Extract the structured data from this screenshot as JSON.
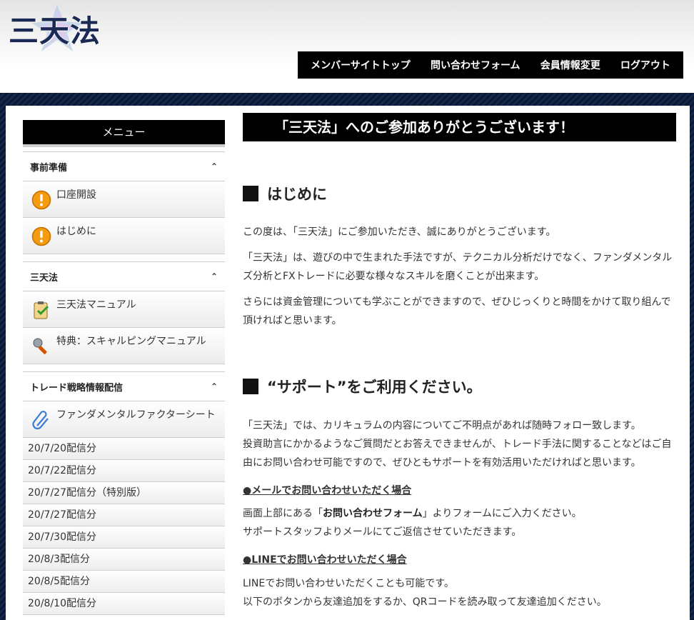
{
  "header": {
    "logo_text": "三天法",
    "nav": [
      {
        "label": "メンバーサイトトップ"
      },
      {
        "label": "問い合わせフォーム"
      },
      {
        "label": "会員情報変更"
      },
      {
        "label": "ログアウト"
      }
    ]
  },
  "sidebar": {
    "title": "メニュー",
    "sections": [
      {
        "title": "事前準備",
        "items": [
          "口座開設",
          "はじめに"
        ]
      },
      {
        "title": "三天法",
        "items": [
          "三天法マニュアル",
          "特典：スキャルピングマニュアル"
        ]
      },
      {
        "title": "トレード戦略情報配信",
        "items": [
          "ファンダメンタルファクターシート"
        ]
      }
    ],
    "dates": [
      "20/7/20配信分",
      "20/7/22配信分",
      "20/7/27配信分（特別版）",
      "20/7/27配信分",
      "20/7/30配信分",
      "20/8/3配信分",
      "20/8/5配信分",
      "20/8/10配信分"
    ]
  },
  "main": {
    "banner": "「三天法」へのご参加ありがとうございます！",
    "h_intro": "はじめに",
    "intro_p1": "この度は、「三天法」にご参加いただき、誠にありがとうございます。",
    "intro_p2": "「三天法」は、遊びの中で生まれた手法ですが、テクニカル分析だけでなく、ファンダメンタルズ分析とFXトレードに必要な様々なスキルを磨くことが出来ます。",
    "intro_p3": "さらには資金管理についても学ぶことができますので、ぜひじっくりと時間をかけて取り組んで頂ければと思います。",
    "h_support": "“サポート”をご利用ください。",
    "support_p1": "「三天法」では、カリキュラムの内容についてご不明点があれば随時フォロー致します。",
    "support_p2": "投資助言にかかるようなご質問だとお答えできませんが、トレード手法に関することなどはご自由にお問い合わせ可能ですので、ぜひともサポートを有効活用いただければと思います。",
    "mail_head": "●メールでお問い合わせいただく場合",
    "mail_p1_pre": "画面上部にある「",
    "mail_p1_bold": "お問い合わせフォーム",
    "mail_p1_post": "」よりフォームにご入力ください。",
    "mail_p2": "サポートスタッフよりメールにてご返信させていただきます。",
    "line_head": "●LINEでお問い合わせいただく場合",
    "line_p1": "LINEでお問い合わせいただくことも可能です。",
    "line_p2": "以下のボタンから友達追加をするか、QRコードを読み取って友達追加ください。"
  }
}
